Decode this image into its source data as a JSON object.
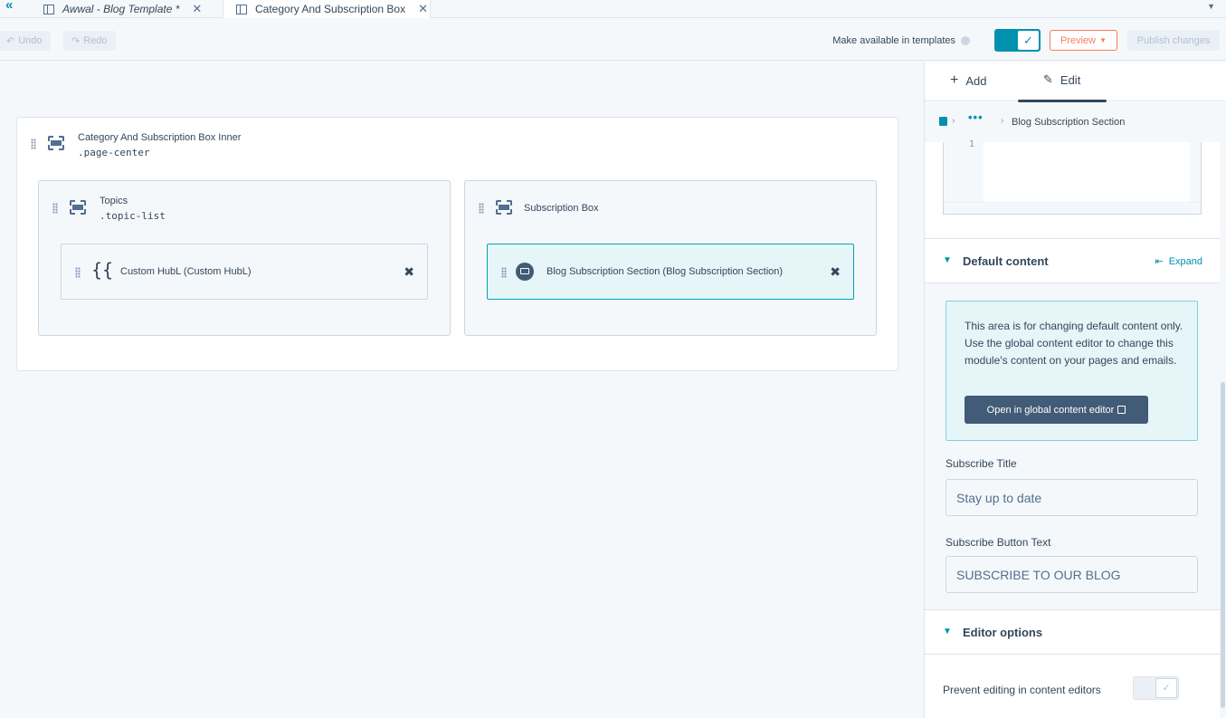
{
  "tabs": [
    {
      "label": "Awwal - Blog Template *",
      "active": false
    },
    {
      "label": "Category And Subscription Box",
      "active": true
    }
  ],
  "toolbar": {
    "undo_label": "Undo",
    "redo_label": "Redo",
    "make_available_label": "Make available in templates",
    "preview_label": "Preview",
    "publish_label": "Publish changes"
  },
  "canvas": {
    "outer_group": {
      "title": "Category And Subscription Box Inner",
      "css_class": ".page-center"
    },
    "topics_group": {
      "title": "Topics",
      "css_class": ".topic-list"
    },
    "subscription_group": {
      "title": "Subscription Box"
    },
    "hubl_module": {
      "label": "Custom HubL (Custom HubL)"
    },
    "subscription_module": {
      "label": "Blog Subscription Section (Blog Subscription Section)"
    }
  },
  "panel": {
    "add_tab": "Add",
    "edit_tab": "Edit",
    "breadcrumb_dots": "•••",
    "breadcrumb_current": "Blog Subscription Section",
    "code_line_number": "1",
    "default_content": {
      "title": "Default content",
      "expand_label": "Expand",
      "notice": "This area is for changing default content only. Use the global content editor to change this module's content on your pages and emails.",
      "global_editor_button": "Open in global content editor"
    },
    "fields": {
      "subscribe_title_label": "Subscribe Title",
      "subscribe_title_value": "Stay up to date",
      "subscribe_button_label": "Subscribe Button Text",
      "subscribe_button_value": "SUBSCRIBE TO OUR BLOG"
    },
    "editor_options": {
      "title": "Editor options",
      "prevent_editing_label": "Prevent editing in content editors"
    }
  },
  "colors": {
    "accent": "#0091ae",
    "preview_orange": "#ff7a59",
    "selected_module_bg": "#e5f5f8",
    "dark_button": "#425b76"
  }
}
